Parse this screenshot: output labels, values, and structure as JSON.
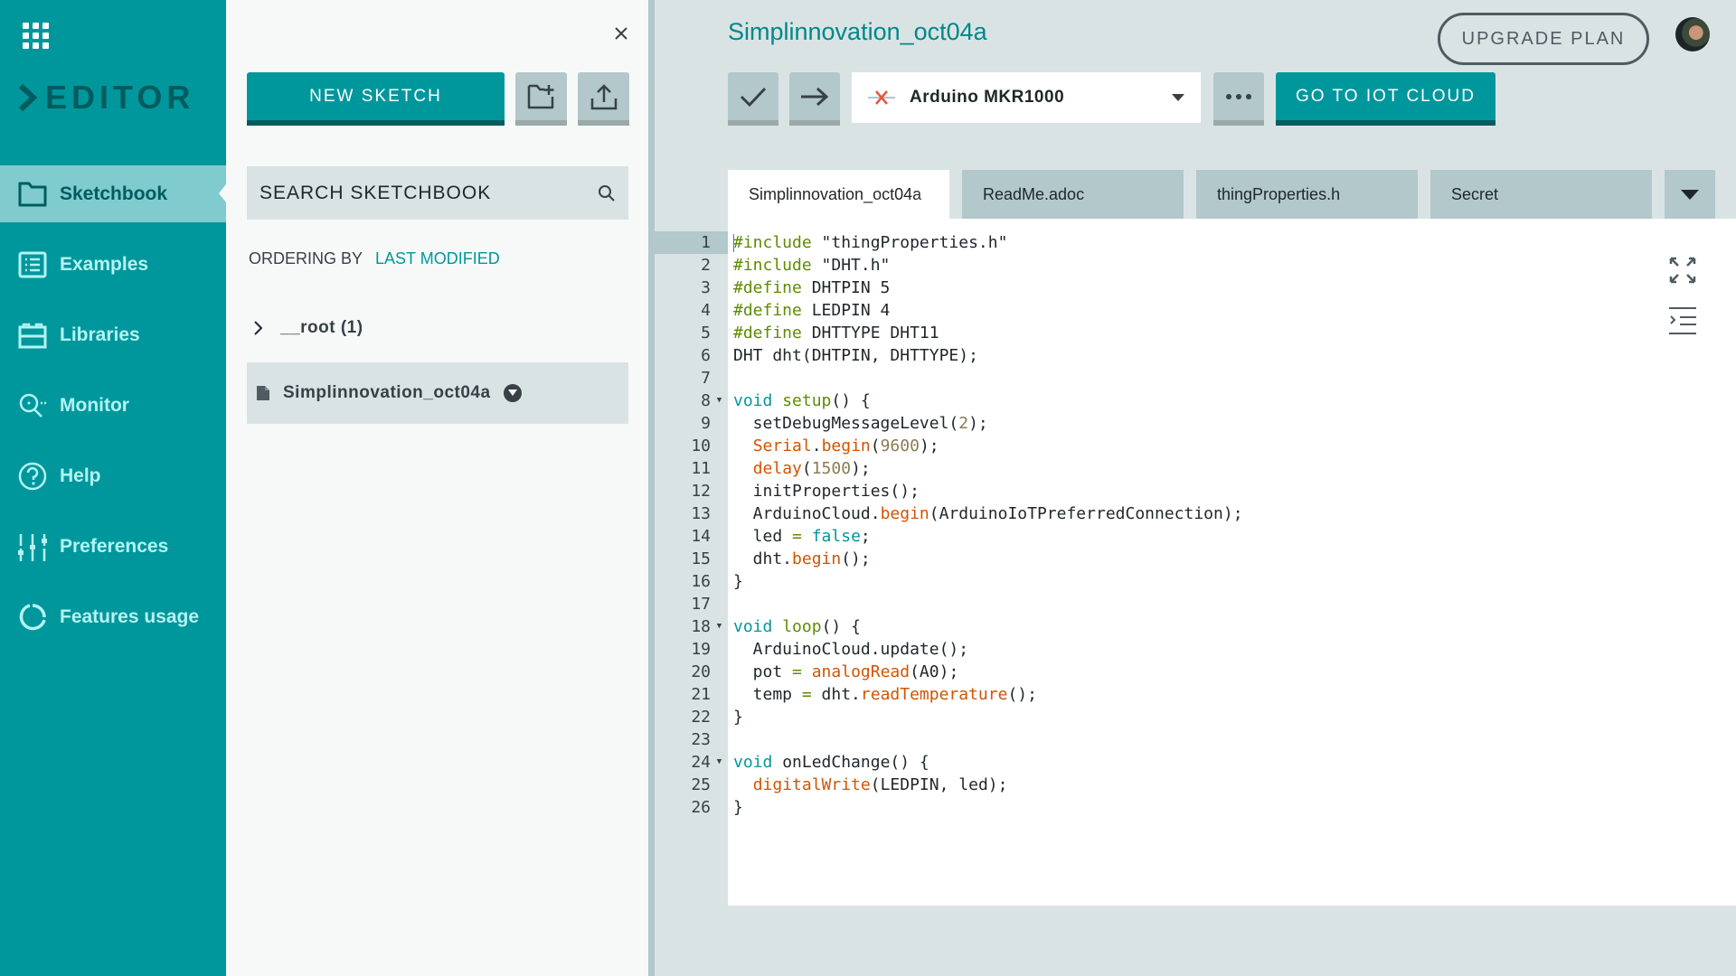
{
  "sidebar": {
    "brand": "EDITOR",
    "items": [
      {
        "label": "Sketchbook",
        "icon": "folder-icon",
        "active": true
      },
      {
        "label": "Examples",
        "icon": "list-icon",
        "active": false
      },
      {
        "label": "Libraries",
        "icon": "library-icon",
        "active": false
      },
      {
        "label": "Monitor",
        "icon": "monitor-icon",
        "active": false
      },
      {
        "label": "Help",
        "icon": "help-icon",
        "active": false
      },
      {
        "label": "Preferences",
        "icon": "sliders-icon",
        "active": false
      },
      {
        "label": "Features usage",
        "icon": "usage-icon",
        "active": false
      }
    ]
  },
  "panel": {
    "close": "×",
    "new_sketch": "NEW SKETCH",
    "search_placeholder": "SEARCH SKETCHBOOK",
    "ordering_label": "ORDERING BY",
    "ordering_value": "LAST MODIFIED",
    "folder": "__root (1)",
    "sketch": "Simplinnovation_oct04a"
  },
  "header": {
    "sketch_title": "Simplinnovation_oct04a",
    "board": "Arduino MKR1000",
    "upgrade": "UPGRADE PLAN",
    "iot_cloud": "GO TO IOT CLOUD",
    "more": "•••"
  },
  "tabs": [
    {
      "label": "Simplinnovation_oct04a",
      "active": true
    },
    {
      "label": "ReadMe.adoc",
      "active": false
    },
    {
      "label": "thingProperties.h",
      "active": false
    },
    {
      "label": "Secret",
      "active": false
    }
  ],
  "code": [
    {
      "n": "1",
      "fold": false,
      "tokens": [
        [
          "pre",
          "#include"
        ],
        [
          "",
          " \"thingProperties.h\""
        ]
      ]
    },
    {
      "n": "2",
      "fold": false,
      "tokens": [
        [
          "pre",
          "#include"
        ],
        [
          "",
          " \"DHT.h\""
        ]
      ]
    },
    {
      "n": "3",
      "fold": false,
      "tokens": [
        [
          "pre",
          "#define"
        ],
        [
          "",
          " DHTPIN 5"
        ]
      ]
    },
    {
      "n": "4",
      "fold": false,
      "tokens": [
        [
          "pre",
          "#define"
        ],
        [
          "",
          " LEDPIN 4"
        ]
      ]
    },
    {
      "n": "5",
      "fold": false,
      "tokens": [
        [
          "pre",
          "#define"
        ],
        [
          "",
          " DHTTYPE DHT11"
        ]
      ]
    },
    {
      "n": "6",
      "fold": false,
      "tokens": [
        [
          "",
          "DHT dht(DHTPIN, DHTTYPE);"
        ]
      ]
    },
    {
      "n": "7",
      "fold": false,
      "tokens": []
    },
    {
      "n": "8",
      "fold": true,
      "tokens": [
        [
          "kw",
          "void"
        ],
        [
          "",
          " "
        ],
        [
          "def",
          "setup"
        ],
        [
          "",
          "() {"
        ]
      ]
    },
    {
      "n": "9",
      "fold": false,
      "tokens": [
        [
          "",
          "  setDebugMessageLevel("
        ],
        [
          "num",
          "2"
        ],
        [
          "",
          ");"
        ]
      ]
    },
    {
      "n": "10",
      "fold": false,
      "tokens": [
        [
          "",
          "  "
        ],
        [
          "fn",
          "Serial"
        ],
        [
          "",
          "."
        ],
        [
          "fn",
          "begin"
        ],
        [
          "",
          "("
        ],
        [
          "num",
          "9600"
        ],
        [
          "",
          ");"
        ]
      ]
    },
    {
      "n": "11",
      "fold": false,
      "tokens": [
        [
          "",
          "  "
        ],
        [
          "fn",
          "delay"
        ],
        [
          "",
          "("
        ],
        [
          "num",
          "1500"
        ],
        [
          "",
          ");"
        ]
      ]
    },
    {
      "n": "12",
      "fold": false,
      "tokens": [
        [
          "",
          "  initProperties();"
        ]
      ]
    },
    {
      "n": "13",
      "fold": false,
      "tokens": [
        [
          "",
          "  ArduinoCloud."
        ],
        [
          "fn",
          "begin"
        ],
        [
          "",
          "(ArduinoIoTPreferredConnection);"
        ]
      ]
    },
    {
      "n": "14",
      "fold": false,
      "tokens": [
        [
          "",
          "  led "
        ],
        [
          "op",
          "="
        ],
        [
          "",
          " "
        ],
        [
          "kw",
          "false"
        ],
        [
          "",
          ";"
        ]
      ]
    },
    {
      "n": "15",
      "fold": false,
      "tokens": [
        [
          "",
          "  dht."
        ],
        [
          "fn",
          "begin"
        ],
        [
          "",
          "();"
        ]
      ]
    },
    {
      "n": "16",
      "fold": false,
      "tokens": [
        [
          "",
          "}"
        ]
      ]
    },
    {
      "n": "17",
      "fold": false,
      "tokens": []
    },
    {
      "n": "18",
      "fold": true,
      "tokens": [
        [
          "kw",
          "void"
        ],
        [
          "",
          " "
        ],
        [
          "def",
          "loop"
        ],
        [
          "",
          "() {"
        ]
      ]
    },
    {
      "n": "19",
      "fold": false,
      "tokens": [
        [
          "",
          "  ArduinoCloud.update();"
        ]
      ]
    },
    {
      "n": "20",
      "fold": false,
      "tokens": [
        [
          "",
          "  pot "
        ],
        [
          "op",
          "="
        ],
        [
          "",
          " "
        ],
        [
          "fn",
          "analogRead"
        ],
        [
          "",
          "(A0);"
        ]
      ]
    },
    {
      "n": "21",
      "fold": false,
      "tokens": [
        [
          "",
          "  temp "
        ],
        [
          "op",
          "="
        ],
        [
          "",
          " dht."
        ],
        [
          "fn",
          "readTemperature"
        ],
        [
          "",
          "();"
        ]
      ]
    },
    {
      "n": "22",
      "fold": false,
      "tokens": [
        [
          "",
          "}"
        ]
      ]
    },
    {
      "n": "23",
      "fold": false,
      "tokens": []
    },
    {
      "n": "24",
      "fold": true,
      "tokens": [
        [
          "kw",
          "void"
        ],
        [
          "",
          " onLedChange() {"
        ]
      ]
    },
    {
      "n": "25",
      "fold": false,
      "tokens": [
        [
          "",
          "  "
        ],
        [
          "fn",
          "digitalWrite"
        ],
        [
          "",
          "(LEDPIN, led);"
        ]
      ]
    },
    {
      "n": "26",
      "fold": false,
      "tokens": [
        [
          "",
          "}"
        ]
      ]
    }
  ],
  "colors": {
    "brand": "#00979c",
    "brand_dark": "#005c5f",
    "sidebar_active": "#7fcbcd",
    "error": "#e05a3a"
  }
}
